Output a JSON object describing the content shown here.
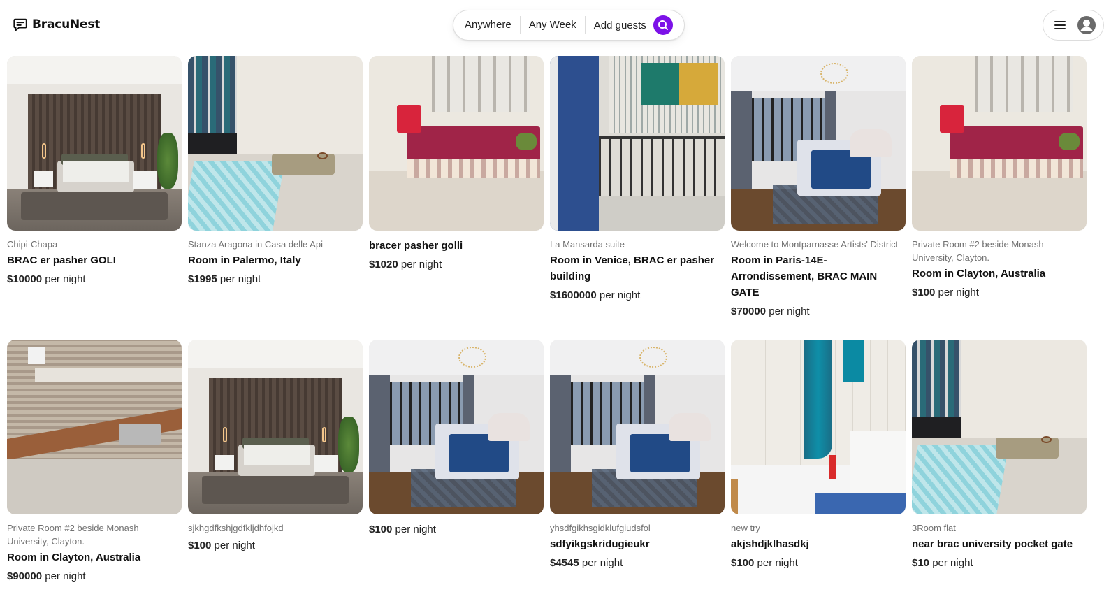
{
  "app": {
    "name": "BracuNest"
  },
  "icons": {
    "logo": "chat-bubble-icon",
    "search": "search-icon",
    "menu": "hamburger-icon",
    "user": "user-avatar-icon"
  },
  "colors": {
    "accent": "#7c11e8",
    "text": "#222222",
    "muted": "#717171",
    "border": "#dddddd"
  },
  "search": {
    "where": "Anywhere",
    "when": "Any Week",
    "guests": "Add guests"
  },
  "price_suffix": "per night",
  "listings": [
    {
      "subtitle": "Chipi-Chapa",
      "title": "BRAC er pasher GOLI",
      "price": "$10000",
      "suffix": "per night",
      "photo": "bedroom-dark-panels"
    },
    {
      "subtitle": "Stanza Aragona in Casa delle Api",
      "title": "Room in Palermo, Italy",
      "price": "$1995",
      "suffix": "per night",
      "photo": "room-blue-bed"
    },
    {
      "subtitle": "",
      "title": "bracer pasher golli",
      "price": "$1020",
      "suffix": "per night",
      "photo": "room-red-bed"
    },
    {
      "subtitle": "La Mansarda suite",
      "title": "Room in Venice, BRAC er pasher building",
      "price": "$1600000",
      "suffix": "per night",
      "photo": "balcony-door"
    },
    {
      "subtitle": "Welcome to Montparnasse Artists' District",
      "title": "Room in Paris-14E-Arrondissement, BRAC MAIN GATE",
      "price": "$70000",
      "suffix": "per night",
      "photo": "chandelier-bedroom"
    },
    {
      "subtitle": "Private Room #2 beside Monash University, Clayton.",
      "title": "Room in Clayton, Australia",
      "price": "$100",
      "suffix": "per night",
      "photo": "room-red-bed"
    },
    {
      "subtitle": "Private Room #2 beside Monash University, Clayton.",
      "title": "Room in Clayton, Australia",
      "price": "$90000",
      "suffix": "per night",
      "photo": "kitchen"
    },
    {
      "subtitle": "sjkhgdfkshjgdfkljdhfojkd",
      "title": "",
      "price": "$100",
      "suffix": "per night",
      "photo": "bedroom-dark-panels"
    },
    {
      "subtitle": "",
      "title": "",
      "price": "$100",
      "suffix": "per night",
      "photo": "chandelier-bedroom"
    },
    {
      "subtitle": "yhsdfgikhsgidklufgiudsfol",
      "title": "sdfyikgskridugieukr",
      "price": "$4545",
      "suffix": "per night",
      "photo": "chandelier-bedroom"
    },
    {
      "subtitle": "new try",
      "title": "akjshdjklhasdkj",
      "price": "$100",
      "suffix": "per night",
      "photo": "bathroom"
    },
    {
      "subtitle": "3Room flat",
      "title": "near brac university pocket gate",
      "price": "$10",
      "suffix": "per night",
      "photo": "room-blue-bed"
    }
  ]
}
